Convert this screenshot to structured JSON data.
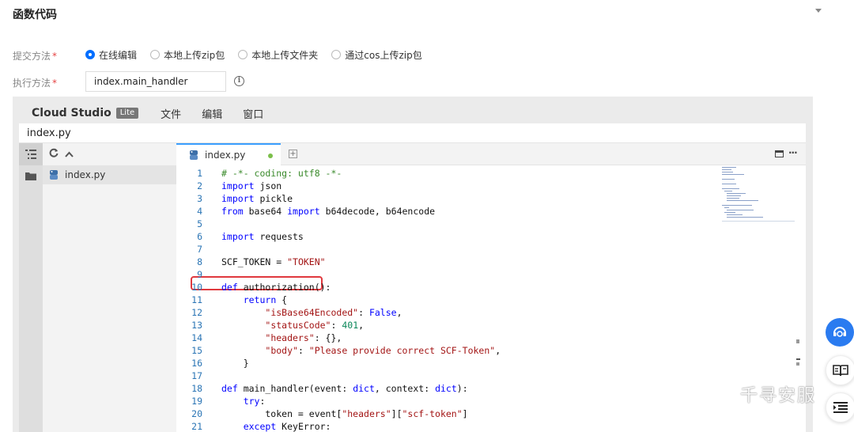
{
  "section": {
    "title": "函数代码"
  },
  "form": {
    "submit_method_label": "提交方法",
    "required_mark": "*",
    "submit_options": [
      {
        "label": "在线编辑",
        "selected": true
      },
      {
        "label": "本地上传zip包",
        "selected": false
      },
      {
        "label": "本地上传文件夹",
        "selected": false
      },
      {
        "label": "通过cos上传zip包",
        "selected": false
      }
    ],
    "handler_label": "执行方法",
    "handler_value": "index.main_handler",
    "info_glyph": "i"
  },
  "ide": {
    "brand": "Cloud Studio",
    "badge": "Lite",
    "menu": [
      "文件",
      "编辑",
      "窗口"
    ],
    "file_title": "index.py",
    "explorer": {
      "file": "index.py"
    },
    "tab": {
      "label": "index.py",
      "modified": true
    },
    "code_lines": [
      {
        "n": "1",
        "t": [
          [
            "cm",
            "# -*- coding: utf8 -*-"
          ]
        ]
      },
      {
        "n": "2",
        "t": [
          [
            "kw",
            "import"
          ],
          [
            "tx",
            " json"
          ]
        ]
      },
      {
        "n": "3",
        "t": [
          [
            "kw",
            "import"
          ],
          [
            "tx",
            " pickle"
          ]
        ]
      },
      {
        "n": "4",
        "t": [
          [
            "kw",
            "from"
          ],
          [
            "tx",
            " base64 "
          ],
          [
            "kw",
            "import"
          ],
          [
            "tx",
            " b64decode, b64encode"
          ]
        ]
      },
      {
        "n": "5",
        "t": []
      },
      {
        "n": "6",
        "t": [
          [
            "kw",
            "import"
          ],
          [
            "tx",
            " requests"
          ]
        ]
      },
      {
        "n": "7",
        "t": []
      },
      {
        "n": "8",
        "t": [
          [
            "tx",
            "SCF_TOKEN = "
          ],
          [
            "str",
            "\"TOKEN\""
          ]
        ]
      },
      {
        "n": "9",
        "t": []
      },
      {
        "n": "10",
        "t": [
          [
            "kw",
            "def"
          ],
          [
            "tx",
            " authorization():"
          ]
        ]
      },
      {
        "n": "11",
        "t": [
          [
            "tx",
            "    "
          ],
          [
            "kw",
            "return"
          ],
          [
            "tx",
            " {"
          ]
        ]
      },
      {
        "n": "12",
        "t": [
          [
            "tx",
            "        "
          ],
          [
            "str",
            "\"isBase64Encoded\""
          ],
          [
            "tx",
            ": "
          ],
          [
            "kw",
            "False"
          ],
          [
            "tx",
            ","
          ]
        ]
      },
      {
        "n": "13",
        "t": [
          [
            "tx",
            "        "
          ],
          [
            "str",
            "\"statusCode\""
          ],
          [
            "tx",
            ": "
          ],
          [
            "num",
            "401"
          ],
          [
            "tx",
            ","
          ]
        ]
      },
      {
        "n": "14",
        "t": [
          [
            "tx",
            "        "
          ],
          [
            "str",
            "\"headers\""
          ],
          [
            "tx",
            ": {},"
          ]
        ]
      },
      {
        "n": "15",
        "t": [
          [
            "tx",
            "        "
          ],
          [
            "str",
            "\"body\""
          ],
          [
            "tx",
            ": "
          ],
          [
            "str",
            "\"Please provide correct SCF-Token\""
          ],
          [
            "tx",
            ","
          ]
        ]
      },
      {
        "n": "16",
        "t": [
          [
            "tx",
            "    }"
          ]
        ]
      },
      {
        "n": "17",
        "t": []
      },
      {
        "n": "18",
        "t": [
          [
            "kw",
            "def"
          ],
          [
            "tx",
            " main_handler(event: "
          ],
          [
            "kw",
            "dict"
          ],
          [
            "tx",
            ", context: "
          ],
          [
            "kw",
            "dict"
          ],
          [
            "tx",
            "):"
          ]
        ]
      },
      {
        "n": "19",
        "t": [
          [
            "tx",
            "    "
          ],
          [
            "kw",
            "try"
          ],
          [
            "tx",
            ":"
          ]
        ]
      },
      {
        "n": "20",
        "t": [
          [
            "tx",
            "        token = event["
          ],
          [
            "str",
            "\"headers\""
          ],
          [
            "tx",
            "]["
          ],
          [
            "str",
            "\"scf-token\""
          ],
          [
            "tx",
            "]"
          ]
        ]
      },
      {
        "n": "21",
        "t": [
          [
            "tx",
            "    "
          ],
          [
            "kw",
            "except"
          ],
          [
            "tx",
            " KeyError:"
          ]
        ]
      }
    ]
  },
  "watermark": {
    "text": "千寻安服"
  },
  "colors": {
    "accent": "#006eff",
    "highlight": "#e0393e",
    "keyword": "#0000ff",
    "string": "#a31515",
    "comment": "#3a8a2b",
    "number": "#098658"
  }
}
